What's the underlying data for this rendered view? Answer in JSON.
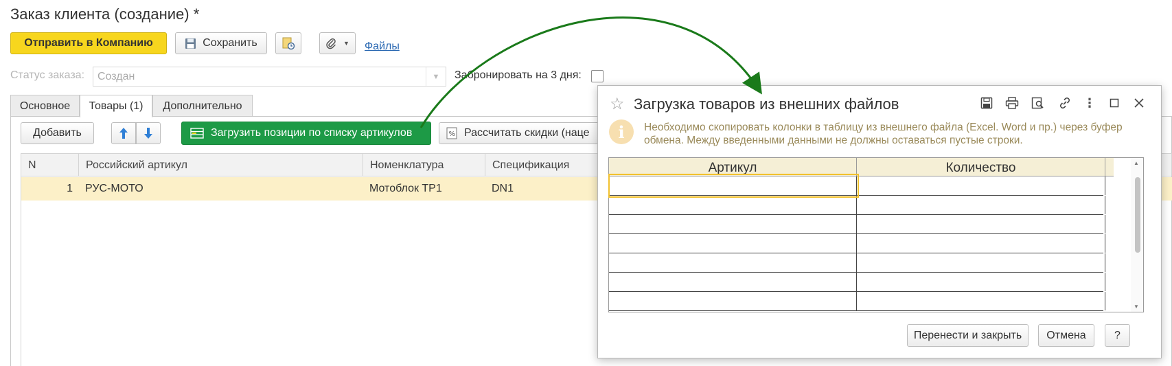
{
  "form": {
    "title": "Заказ клиента (создание) *",
    "send_button": "Отправить в Компанию",
    "save_button": "Сохранить",
    "files_link": "Файлы",
    "status_label": "Статус заказа:",
    "status_value": "Создан",
    "reserve_label": "Забронировать на 3 дня:",
    "reserve_checked": false
  },
  "tabs": [
    {
      "label": "Основное",
      "active": false
    },
    {
      "label": "Товары (1)",
      "active": true
    },
    {
      "label": "Дополнительно",
      "active": false
    }
  ],
  "goods_toolbar": {
    "add_button": "Добавить",
    "load_button": "Загрузить позиции по списку артикулов",
    "discount_button": "Рассчитать скидки (наце"
  },
  "goods_table": {
    "columns": [
      "N",
      "Российский артикул",
      "Номенклатура",
      "Спецификация"
    ],
    "rows": [
      {
        "n": "1",
        "article": "РУС-МОТО",
        "nomenclature": "Мотоблок ТР1",
        "spec": "DN1"
      }
    ]
  },
  "dialog": {
    "title": "Загрузка товаров из внешних файлов",
    "info": "Необходимо скопировать колонки в таблицу из внешнего файла (Excel. Word и пр.) через буфер обмена. Между введенными данными не должны оставаться пустые строки.",
    "columns": [
      "Артикул",
      "Количество"
    ],
    "empty_rows": 7,
    "transfer_button": "Перенести и закрыть",
    "cancel_button": "Отмена",
    "help_button": "?"
  },
  "colors": {
    "accent_yellow": "#f7d61e",
    "accent_green": "#1d9a46",
    "selected_row": "#fcf0c8",
    "arrow": "#1a7a1a"
  }
}
